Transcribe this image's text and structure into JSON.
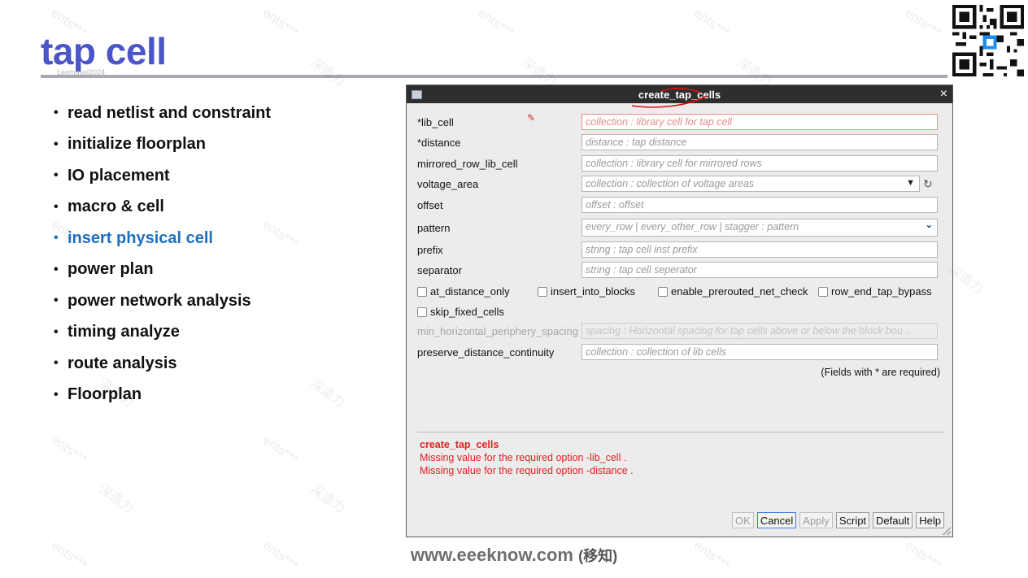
{
  "slide": {
    "title": "tap cell",
    "watermark_small": "Leemusel2024",
    "bullets": [
      {
        "text": "read netlist and constraint",
        "active": false
      },
      {
        "text": "initialize floorplan",
        "active": false
      },
      {
        "text": "IO placement",
        "active": false
      },
      {
        "text": "macro & cell",
        "active": false
      },
      {
        "text": "insert physical cell",
        "active": true
      },
      {
        "text": "power plan",
        "active": false
      },
      {
        "text": "power network analysis",
        "active": false
      },
      {
        "text": "timing analyze",
        "active": false
      },
      {
        "text": "route analysis",
        "active": false
      },
      {
        "text": "Floorplan",
        "active": false
      }
    ],
    "bullet_char": "•",
    "colors": {
      "title": "#4a55c8",
      "active_bullet": "#1f6fc0",
      "error": "#e02020"
    }
  },
  "dialog": {
    "title": "create_tap_cells",
    "close_glyph": "×",
    "fields": [
      {
        "label": "*lib_cell",
        "placeholder": "collection : library cell for tap cell",
        "required": true
      },
      {
        "label": "*distance",
        "placeholder": "distance : tap distance",
        "required": false
      },
      {
        "label": "mirrored_row_lib_cell",
        "placeholder": "collection : library cell for mirrored rows"
      },
      {
        "label": "voltage_area",
        "placeholder": "collection : collection of voltage areas",
        "type": "select"
      },
      {
        "label": "offset",
        "placeholder": "offset : offset"
      },
      {
        "label": "pattern",
        "placeholder": "every_row | every_other_row | stagger : pattern",
        "type": "combo"
      },
      {
        "label": "prefix",
        "placeholder": "string : tap cell inst prefix"
      },
      {
        "label": "separator",
        "placeholder": "string : tap cell seperator"
      }
    ],
    "checkboxes_row1": [
      "at_distance_only",
      "insert_into_blocks",
      "enable_prerouted_net_check",
      "row_end_tap_bypass"
    ],
    "checkboxes_row2": [
      "skip_fixed_cells"
    ],
    "field_disabled": {
      "label": "min_horizontal_periphery_spacing",
      "placeholder": "spacing : Horizontal spacing for tap cells above or below the block bou..."
    },
    "field_preserve": {
      "label": "preserve_distance_continuity",
      "placeholder": "collection : collection of lib cells"
    },
    "required_note": "(Fields with * are required)",
    "messages": {
      "command": "create_tap_cells",
      "line1": "Missing value for the required option -lib_cell .",
      "line2": "Missing value for the required option -distance ."
    },
    "buttons": {
      "ok": "OK",
      "cancel": "Cancel",
      "apply": "Apply",
      "script": "Script",
      "default": "Default",
      "help": "Help"
    },
    "icons": {
      "dropdown": "▼",
      "chevron": "⌄",
      "refresh": "↻",
      "pen": "✎"
    }
  },
  "footer": {
    "url": "www.eeeknow.com",
    "cn": "(移知)"
  },
  "watermarks": [
    "ents***",
    "深造力"
  ]
}
